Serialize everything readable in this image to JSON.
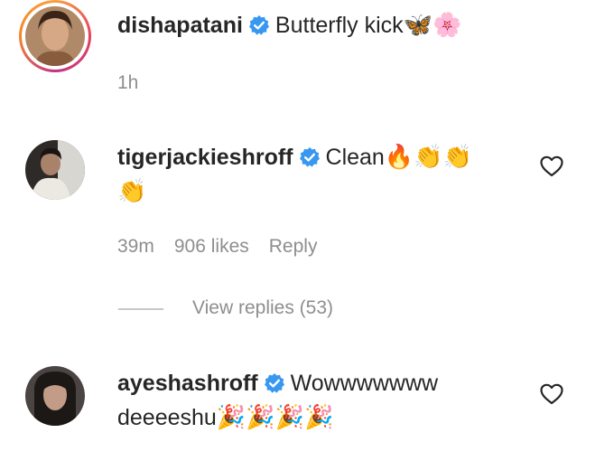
{
  "comments": [
    {
      "username": "dishapatani",
      "verified": true,
      "text": "Butterfly kick",
      "emojis": "🦋🌸",
      "time": "1h"
    },
    {
      "username": "tigerjackieshroff",
      "verified": true,
      "text": "Clean",
      "emojis_line1": "🔥👏👏",
      "emojis_line2": "👏",
      "time": "39m",
      "likes": "906 likes",
      "reply_label": "Reply",
      "view_replies": "View replies (53)"
    },
    {
      "username": "ayeshashroff",
      "verified": true,
      "text_line1": "Wowwwwwww",
      "text_line2": "deeeeshu",
      "emojis": "🎉🎉🎉🎉"
    }
  ],
  "colors": {
    "text": "#262626",
    "meta": "#8e8e8e",
    "verified": "#3897f0"
  }
}
